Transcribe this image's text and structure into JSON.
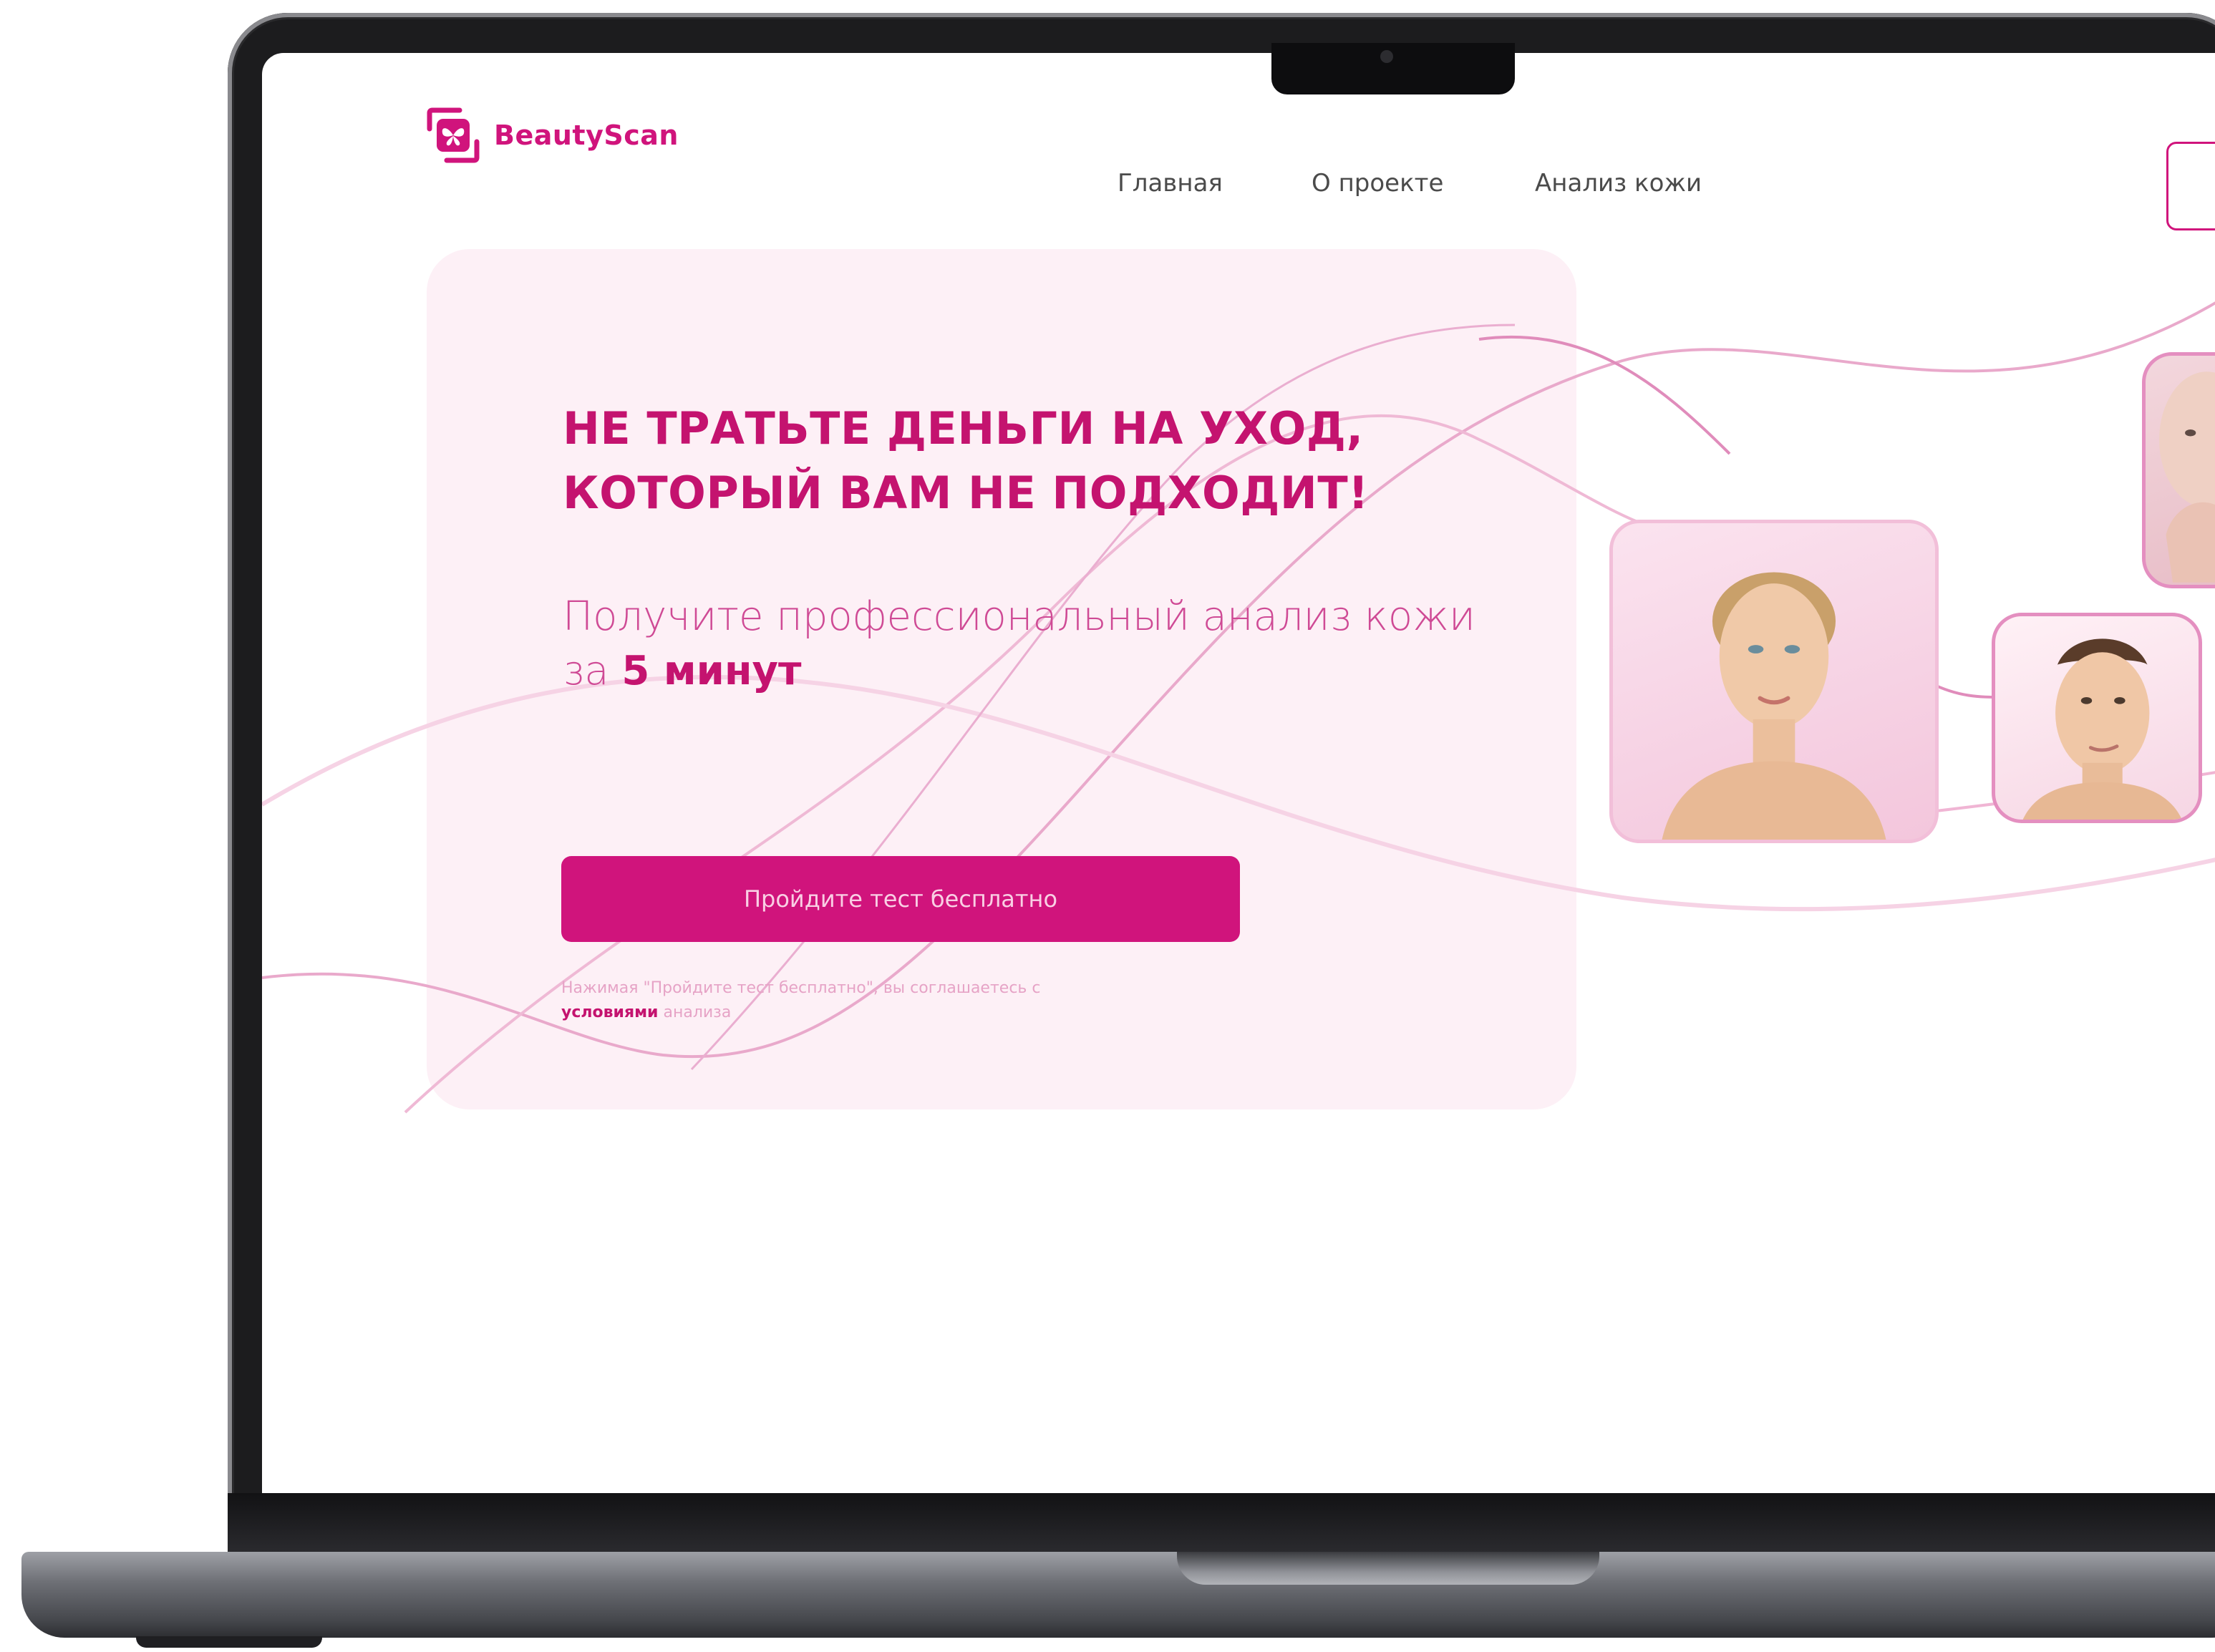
{
  "brand": {
    "name": "BeautyScan",
    "color": "#d0147c"
  },
  "nav": {
    "items": [
      "Главная",
      "О проекте",
      "Анализ кожи"
    ]
  },
  "hero": {
    "headline_line1": "НЕ ТРАТЬТЕ ДЕНЬГИ НА УХОД,",
    "headline_line2": "КОТОРЫЙ ВАМ НЕ ПОДХОДИТ!",
    "subline_prefix": "Получите профессиональный анализ кожи за ",
    "subline_bold": "5 минут",
    "cta_label": "Пройдите тест бесплатно",
    "agree_text": "Нажимая \"Пройдите тест бесплатно\", вы соглашаетесь с",
    "agree_link": "условиями",
    "agree_suffix": " анализа"
  },
  "icons": {
    "logo": "butterfly-scan-logo-icon",
    "photos": [
      "woman-face-photo",
      "man-face-photo",
      "woman-hand-face-photo"
    ]
  },
  "colors": {
    "accent": "#d0147c",
    "card_bg": "#fdf0f6",
    "nav_text": "#4b4b4b"
  }
}
